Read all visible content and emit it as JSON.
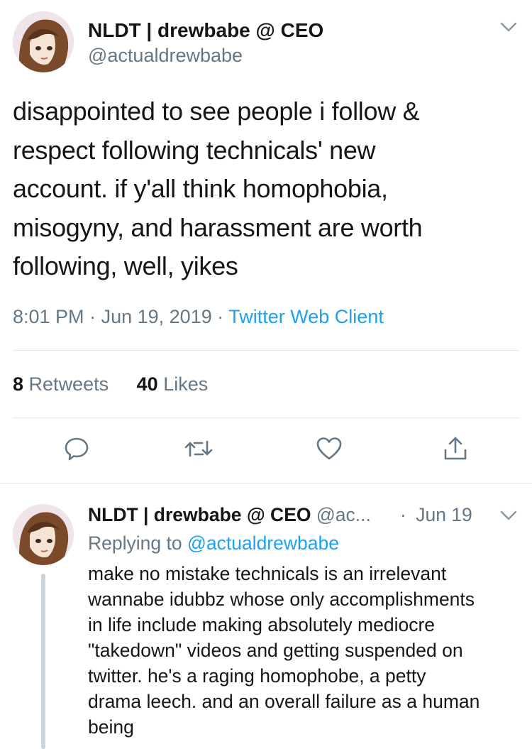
{
  "main_tweet": {
    "display_name": "NLDT | drewbabe @ CEO",
    "handle": "@actualdrewbabe",
    "text_lines": [
      "disappointed to see people i follow &",
      "respect following technicals' new",
      "account. if y'all think homophobia,",
      "misogyny, and harassment are worth",
      "following, well, yikes"
    ],
    "time": "8:01 PM",
    "date": "Jun 19, 2019",
    "separator": "·",
    "client": "Twitter Web Client",
    "retweet_count": "8",
    "retweet_label": "Retweets",
    "like_count": "40",
    "like_label": "Likes",
    "actions": [
      "reply-icon",
      "retweet-icon",
      "like-icon",
      "share-icon"
    ]
  },
  "reply_tweet": {
    "display_name": "NLDT | drewbabe @ CEO",
    "handle_truncated": "@ac...",
    "separator": "·",
    "date": "Jun 19",
    "replying_prefix": "Replying to",
    "replying_handle": "@actualdrewbabe",
    "text_lines": [
      "make no mistake technicals is an irrelevant",
      "wannabe idubbz whose only accomplishments",
      "in life include making absolutely mediocre",
      "\"takedown\" videos and getting suspended on",
      "twitter. he's a raging homophobe, a petty",
      "drama leech. and an overall failure as a human",
      "being"
    ]
  },
  "colors": {
    "text": "#14171a",
    "secondary": "#657786",
    "link": "#1da1f2",
    "divider": "#e1e8ed",
    "thread_line": "#ccd6dd"
  }
}
